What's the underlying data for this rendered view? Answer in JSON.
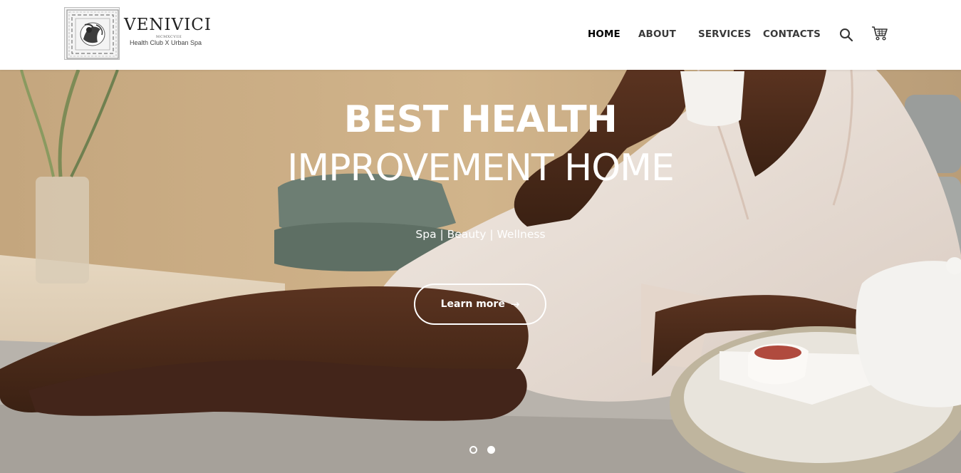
{
  "header": {
    "logo": {
      "name": "VENIVICI",
      "year": "MCMXCVIII",
      "tagline": "Health Club  X  Urban Spa"
    },
    "nav": [
      {
        "label": "HOME",
        "active": true
      },
      {
        "label": "ABOUT",
        "active": false
      },
      {
        "label": "SERVICES",
        "active": false
      },
      {
        "label": "CONTACTS",
        "active": false
      }
    ],
    "icons": {
      "search": "search-icon",
      "cart": "cart-icon"
    }
  },
  "hero": {
    "title_line1": "BEST HEALTH",
    "title_line2": "IMPROVEMENT HOME",
    "subtitle": "Spa | Beauty | Wellness",
    "cta_label": "Learn more",
    "cta_icon": "→",
    "slides": {
      "count": 2,
      "active_index": 2
    }
  },
  "colors": {
    "nav_text": "#3a3a3a",
    "nav_active": "#000000",
    "hero_text": "#ffffff",
    "wall": "#c9a97c",
    "towel": "#6c7d72",
    "robe": "#ede3da",
    "skin": "#4a2a18"
  }
}
